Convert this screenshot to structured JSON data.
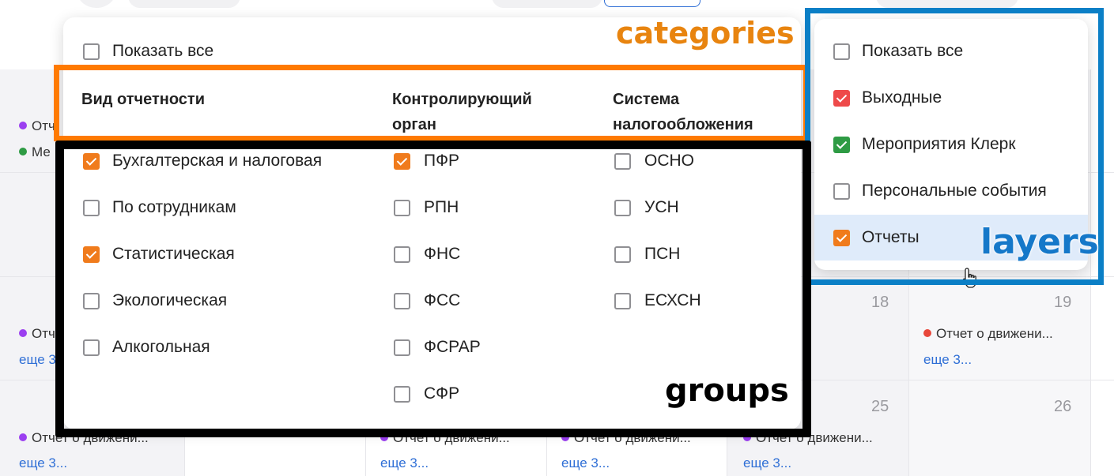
{
  "calendar": {
    "day_numbers": [
      "18",
      "19",
      "25",
      "26"
    ],
    "events": {
      "row1_a": "Отч",
      "row1_b": "Ме",
      "row2_a": "Отч",
      "row2_more": "еще 3",
      "col19_event": "Отчет о движени...",
      "col19_more": "еще 3...",
      "row3_event": "Отчет о движени...",
      "row3_more": "еще 3..."
    },
    "colors": {
      "purple": "#9b3ff0",
      "green": "#2e9b44",
      "red": "#e8473b",
      "link": "#2f6fd6"
    }
  },
  "filter": {
    "show_all_label": "Показать все",
    "columns": [
      {
        "header": "Вид отчетности",
        "items": [
          {
            "label": "Бухгалтерская и налоговая",
            "checked": true
          },
          {
            "label": "По сотрудникам",
            "checked": false
          },
          {
            "label": "Статистическая",
            "checked": true
          },
          {
            "label": "Экологическая",
            "checked": false
          },
          {
            "label": "Алкогольная",
            "checked": false
          }
        ]
      },
      {
        "header_line1": "Контролирующий",
        "header_line2": "орган",
        "items": [
          {
            "label": "ПФР",
            "checked": true
          },
          {
            "label": "РПН",
            "checked": false
          },
          {
            "label": "ФНС",
            "checked": false
          },
          {
            "label": "ФСС",
            "checked": false
          },
          {
            "label": "ФСРАР",
            "checked": false
          },
          {
            "label": "СФР",
            "checked": false
          }
        ]
      },
      {
        "header_line1": "Система",
        "header_line2": "налогообложения",
        "items": [
          {
            "label": "ОСНО",
            "checked": false
          },
          {
            "label": "УСН",
            "checked": false
          },
          {
            "label": "ПСН",
            "checked": false
          },
          {
            "label": "ЕСХСН",
            "checked": false
          }
        ]
      }
    ]
  },
  "layers": {
    "items": [
      {
        "label": "Показать все",
        "checked": false
      },
      {
        "label": "Выходные",
        "checked": true,
        "color": "#ee4a4a"
      },
      {
        "label": "Мероприятия Клерк",
        "checked": true,
        "color": "#2e9b44"
      },
      {
        "label": "Персональные события",
        "checked": false
      },
      {
        "label": "Отчеты",
        "checked": true,
        "color": "#f07b1c",
        "highlighted": true
      }
    ]
  },
  "annotations": {
    "categories": "categories",
    "layers": "layers",
    "groups": "groups"
  },
  "colors": {
    "checkbox_orange": "#f07b1c",
    "frame_orange": "#ff7a00",
    "frame_blue": "#0b7fc6",
    "frame_black": "#000000",
    "label_orange": "#e8840f",
    "label_blue": "#1578c9"
  }
}
